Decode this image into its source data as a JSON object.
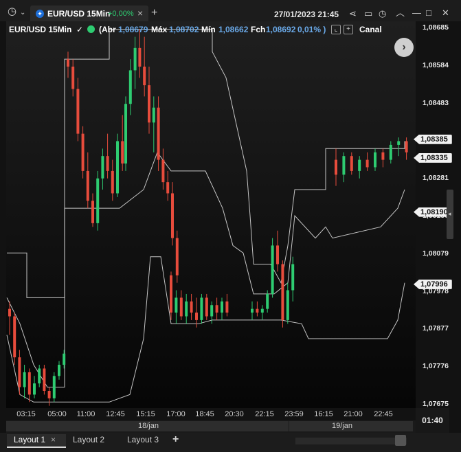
{
  "window": {
    "tab_title": "EUR/USD 15Min",
    "tab_change": "+0,00%",
    "tab_close": "×",
    "new_tab": "+",
    "datetime": "27/01/2023 21:45",
    "icons": [
      "clock-menu-icon",
      "chevron-down-icon",
      "share-icon",
      "window-layout-icon",
      "history-clock-icon",
      "collapse-icon",
      "minimize-icon",
      "maximize-icon",
      "close-icon"
    ]
  },
  "infobar": {
    "symbol": "EUR/USD 15Min",
    "check": "✓",
    "abr_label": "(Abr",
    "abr_value": "1,08679",
    "max_label": "Máx",
    "max_value": "1,08702",
    "min_label": "Mín",
    "min_value": "1,08662",
    "fch_label": "Fch",
    "fch_value": "1,08692",
    "pct": "0,01% )",
    "indicator": "Canal"
  },
  "chart_data": {
    "type": "candlestick",
    "y_ticks": [
      "1,08685",
      "1,08584",
      "1,08483",
      "1,08382",
      "1,08281",
      "1,08180",
      "1,08079",
      "1,07978",
      "1,07877",
      "1,07776",
      "1,07675"
    ],
    "ylim": [
      1.07675,
      1.08685
    ],
    "x_ticks": [
      "03:15",
      "05:00",
      "11:00",
      "12:45",
      "15:15",
      "17:00",
      "18:45",
      "20:30",
      "22:15",
      "23:59",
      "16:15",
      "21:00",
      "22:45"
    ],
    "day_labels": [
      "18/jan",
      "19/jan"
    ],
    "price_labels": [
      "1,08385",
      "1,08335",
      "1,08190",
      "1,07996"
    ],
    "colors": {
      "up": "#2ecc71",
      "down": "#e74c3c",
      "channel": "#d9d9d9"
    },
    "candles": [
      {
        "o": 1.0793,
        "h": 1.0795,
        "l": 1.0786,
        "c": 1.0791
      },
      {
        "o": 1.0791,
        "h": 1.0792,
        "l": 1.0778,
        "c": 1.078
      },
      {
        "o": 1.078,
        "h": 1.0782,
        "l": 1.077,
        "c": 1.0772
      },
      {
        "o": 1.0772,
        "h": 1.0778,
        "l": 1.0769,
        "c": 1.0776
      },
      {
        "o": 1.0776,
        "h": 1.0777,
        "l": 1.0768,
        "c": 1.077
      },
      {
        "o": 1.077,
        "h": 1.0775,
        "l": 1.0769,
        "c": 1.0773
      },
      {
        "o": 1.0773,
        "h": 1.0778,
        "l": 1.0772,
        "c": 1.0777
      },
      {
        "o": 1.0777,
        "h": 1.0778,
        "l": 1.077,
        "c": 1.0771
      },
      {
        "o": 1.0771,
        "h": 1.0772,
        "l": 1.0767,
        "c": 1.0769
      },
      {
        "o": 1.0769,
        "h": 1.0776,
        "l": 1.0768,
        "c": 1.0775
      },
      {
        "o": 1.0775,
        "h": 1.0779,
        "l": 1.0774,
        "c": 1.0778
      },
      {
        "o": 1.0778,
        "h": 1.0782,
        "l": 1.0777,
        "c": 1.0781
      },
      {
        "o": 1.086,
        "h": 1.0862,
        "l": 1.0855,
        "c": 1.0858
      },
      {
        "o": 1.0858,
        "h": 1.086,
        "l": 1.085,
        "c": 1.0852
      },
      {
        "o": 1.0852,
        "h": 1.0855,
        "l": 1.0838,
        "c": 1.084
      },
      {
        "o": 1.084,
        "h": 1.0842,
        "l": 1.0828,
        "c": 1.083
      },
      {
        "o": 1.083,
        "h": 1.0835,
        "l": 1.082,
        "c": 1.0822
      },
      {
        "o": 1.0822,
        "h": 1.0824,
        "l": 1.0815,
        "c": 1.0816
      },
      {
        "o": 1.0816,
        "h": 1.083,
        "l": 1.0814,
        "c": 1.0828
      },
      {
        "o": 1.0828,
        "h": 1.0836,
        "l": 1.0825,
        "c": 1.0834
      },
      {
        "o": 1.0834,
        "h": 1.084,
        "l": 1.0828,
        "c": 1.083
      },
      {
        "o": 1.083,
        "h": 1.0833,
        "l": 1.0822,
        "c": 1.0824
      },
      {
        "o": 1.0824,
        "h": 1.084,
        "l": 1.0823,
        "c": 1.0838
      },
      {
        "o": 1.0838,
        "h": 1.0845,
        "l": 1.083,
        "c": 1.0832
      },
      {
        "o": 1.0832,
        "h": 1.085,
        "l": 1.083,
        "c": 1.0848
      },
      {
        "o": 1.0848,
        "h": 1.086,
        "l": 1.0845,
        "c": 1.0857
      },
      {
        "o": 1.0857,
        "h": 1.0866,
        "l": 1.0852,
        "c": 1.0863
      },
      {
        "o": 1.0863,
        "h": 1.0868,
        "l": 1.0855,
        "c": 1.0858
      },
      {
        "o": 1.0858,
        "h": 1.0866,
        "l": 1.085,
        "c": 1.0853
      },
      {
        "o": 1.0853,
        "h": 1.0858,
        "l": 1.084,
        "c": 1.0843
      },
      {
        "o": 1.0843,
        "h": 1.085,
        "l": 1.0835,
        "c": 1.0847
      },
      {
        "o": 1.0847,
        "h": 1.085,
        "l": 1.083,
        "c": 1.0833
      },
      {
        "o": 1.0833,
        "h": 1.0836,
        "l": 1.0825,
        "c": 1.0827
      },
      {
        "o": 1.0827,
        "h": 1.083,
        "l": 1.0822,
        "c": 1.0824
      },
      {
        "o": 1.0824,
        "h": 1.0827,
        "l": 1.081,
        "c": 1.0812
      },
      {
        "o": 1.0812,
        "h": 1.0814,
        "l": 1.08,
        "c": 1.0802
      },
      {
        "o": 1.0802,
        "h": 1.0803,
        "l": 1.079,
        "c": 1.0792
      },
      {
        "o": 1.0792,
        "h": 1.0798,
        "l": 1.0789,
        "c": 1.0796
      },
      {
        "o": 1.0796,
        "h": 1.0798,
        "l": 1.079,
        "c": 1.0791
      },
      {
        "o": 1.0791,
        "h": 1.0797,
        "l": 1.0789,
        "c": 1.0795
      },
      {
        "o": 1.0795,
        "h": 1.0797,
        "l": 1.079,
        "c": 1.0792
      },
      {
        "o": 1.0792,
        "h": 1.0796,
        "l": 1.0788,
        "c": 1.079
      },
      {
        "o": 1.079,
        "h": 1.0797,
        "l": 1.0789,
        "c": 1.0796
      },
      {
        "o": 1.0796,
        "h": 1.0797,
        "l": 1.079,
        "c": 1.0791
      },
      {
        "o": 1.0791,
        "h": 1.0795,
        "l": 1.0789,
        "c": 1.0794
      },
      {
        "o": 1.0794,
        "h": 1.0796,
        "l": 1.079,
        "c": 1.0792
      },
      {
        "o": 1.0792,
        "h": 1.0796,
        "l": 1.079,
        "c": 1.0795
      },
      {
        "o": 1.0795,
        "h": 1.0797,
        "l": 1.0791,
        "c": 1.0792
      },
      {
        "o": 1.0792,
        "h": 1.0795,
        "l": 1.079,
        "c": 1.0793
      },
      {
        "o": 1.0793,
        "h": 1.0795,
        "l": 1.0791,
        "c": 1.0792
      },
      {
        "o": 1.0792,
        "h": 1.0794,
        "l": 1.079,
        "c": 1.0793
      },
      {
        "o": 1.0793,
        "h": 1.0798,
        "l": 1.0792,
        "c": 1.0797
      },
      {
        "o": 1.0797,
        "h": 1.0812,
        "l": 1.0796,
        "c": 1.081
      },
      {
        "o": 1.081,
        "h": 1.0814,
        "l": 1.0803,
        "c": 1.0805
      },
      {
        "o": 1.0805,
        "h": 1.0806,
        "l": 1.0788,
        "c": 1.079
      },
      {
        "o": 1.079,
        "h": 1.08,
        "l": 1.0789,
        "c": 1.0798
      },
      {
        "o": 1.0798,
        "h": 1.0807,
        "l": 1.0795,
        "c": 1.0805
      },
      {
        "o": 1.0833,
        "h": 1.0836,
        "l": 1.0826,
        "c": 1.0829
      },
      {
        "o": 1.0829,
        "h": 1.0835,
        "l": 1.0827,
        "c": 1.0834
      },
      {
        "o": 1.0834,
        "h": 1.0835,
        "l": 1.0829,
        "c": 1.083
      },
      {
        "o": 1.083,
        "h": 1.0834,
        "l": 1.0828,
        "c": 1.0833
      },
      {
        "o": 1.0833,
        "h": 1.0835,
        "l": 1.083,
        "c": 1.0831
      },
      {
        "o": 1.0831,
        "h": 1.0836,
        "l": 1.083,
        "c": 1.0835
      },
      {
        "o": 1.0835,
        "h": 1.0836,
        "l": 1.0831,
        "c": 1.0833
      },
      {
        "o": 1.0833,
        "h": 1.0838,
        "l": 1.0832,
        "c": 1.0837
      },
      {
        "o": 1.0837,
        "h": 1.0839,
        "l": 1.0834,
        "c": 1.0838
      },
      {
        "o": 1.0838,
        "h": 1.0839,
        "l": 1.0833,
        "c": 1.0835
      }
    ]
  },
  "clock": "01:40",
  "bottom_tabs": [
    {
      "label": "Layout 1",
      "close": "×"
    },
    {
      "label": "Layout 2"
    },
    {
      "label": "Layout 3"
    }
  ],
  "add_layout": "+"
}
